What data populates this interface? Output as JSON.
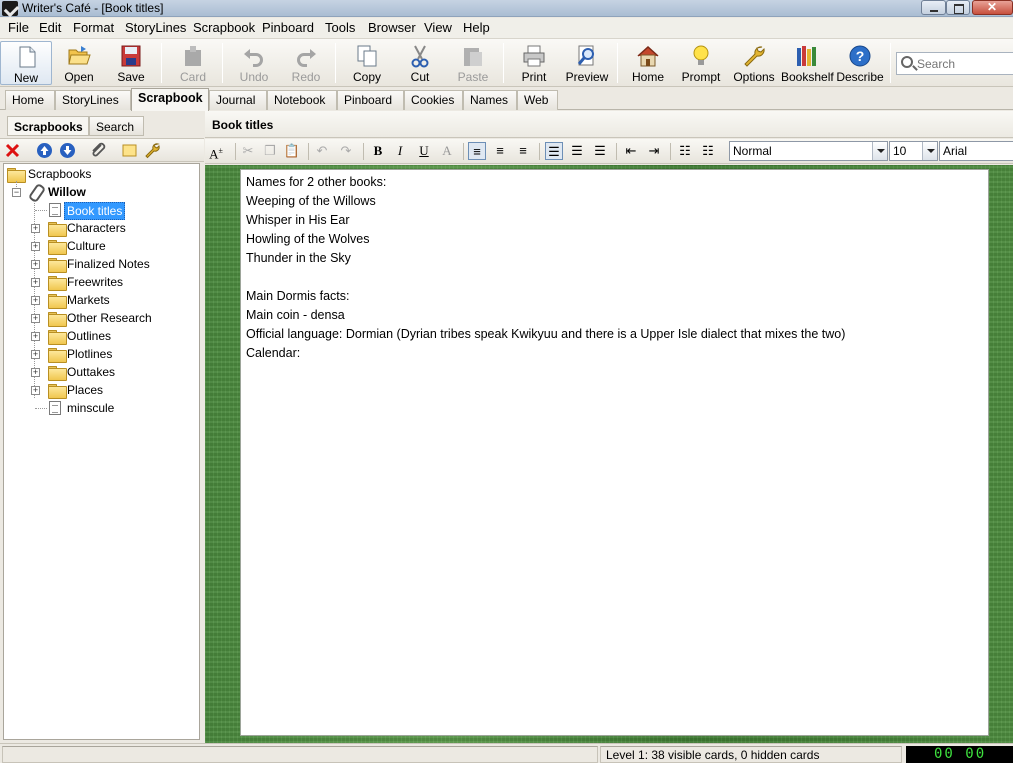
{
  "window": {
    "title": "Writer's Café - [Book titles]"
  },
  "menu": [
    "File",
    "Edit",
    "Format",
    "StoryLines",
    "Scrapbook",
    "Pinboard",
    "Tools",
    "Browser",
    "View",
    "Help"
  ],
  "toolbar": {
    "new": "New",
    "open": "Open",
    "save": "Save",
    "card": "Card",
    "undo": "Undo",
    "redo": "Redo",
    "copy": "Copy",
    "cut": "Cut",
    "paste": "Paste",
    "print": "Print",
    "preview": "Preview",
    "home": "Home",
    "prompt": "Prompt",
    "options": "Options",
    "bookshelf": "Bookshelf",
    "describe": "Describe",
    "search_placeholder": "Search"
  },
  "tabs": [
    "Home",
    "StoryLines",
    "Scrapbook",
    "Journal",
    "Notebook",
    "Pinboard",
    "Cookies",
    "Names",
    "Web"
  ],
  "active_tab": "Scrapbook",
  "sidebar": {
    "tabs": [
      "Scrapbooks",
      "Search"
    ],
    "tree": {
      "root": "Scrapbooks",
      "book": "Willow",
      "items": [
        {
          "label": "Book titles",
          "type": "doc",
          "selected": true
        },
        {
          "label": "Characters",
          "type": "folder"
        },
        {
          "label": "Culture",
          "type": "folder"
        },
        {
          "label": "Finalized Notes",
          "type": "folder"
        },
        {
          "label": "Freewrites",
          "type": "folder"
        },
        {
          "label": "Markets",
          "type": "folder"
        },
        {
          "label": "Other Research",
          "type": "folder"
        },
        {
          "label": "Outlines",
          "type": "folder"
        },
        {
          "label": "Plotlines",
          "type": "folder"
        },
        {
          "label": "Outtakes",
          "type": "folder"
        },
        {
          "label": "Places",
          "type": "folder"
        },
        {
          "label": "minscule",
          "type": "doc"
        }
      ]
    }
  },
  "editor": {
    "title": "Book titles",
    "style": "Normal",
    "size": "10",
    "font": "Arial",
    "lines": [
      "Names for 2 other books:",
      "Weeping of the Willows",
      "Whisper in His Ear",
      "Howling of the Wolves",
      "Thunder in the Sky",
      "",
      "Main Dormis facts:",
      "Main coin - densa",
      "Official language: Dormian (Dyrian tribes speak Kwikyuu and there is a Upper Isle dialect that mixes the two)",
      "Calendar:"
    ]
  },
  "status": {
    "text": "Level 1: 38 visible cards, 0 hidden cards",
    "clock": "00 00"
  },
  "colors": {
    "selection": "#3399ff",
    "background_grass": "#4b8b3e",
    "clock_text": "#3ee03e"
  }
}
